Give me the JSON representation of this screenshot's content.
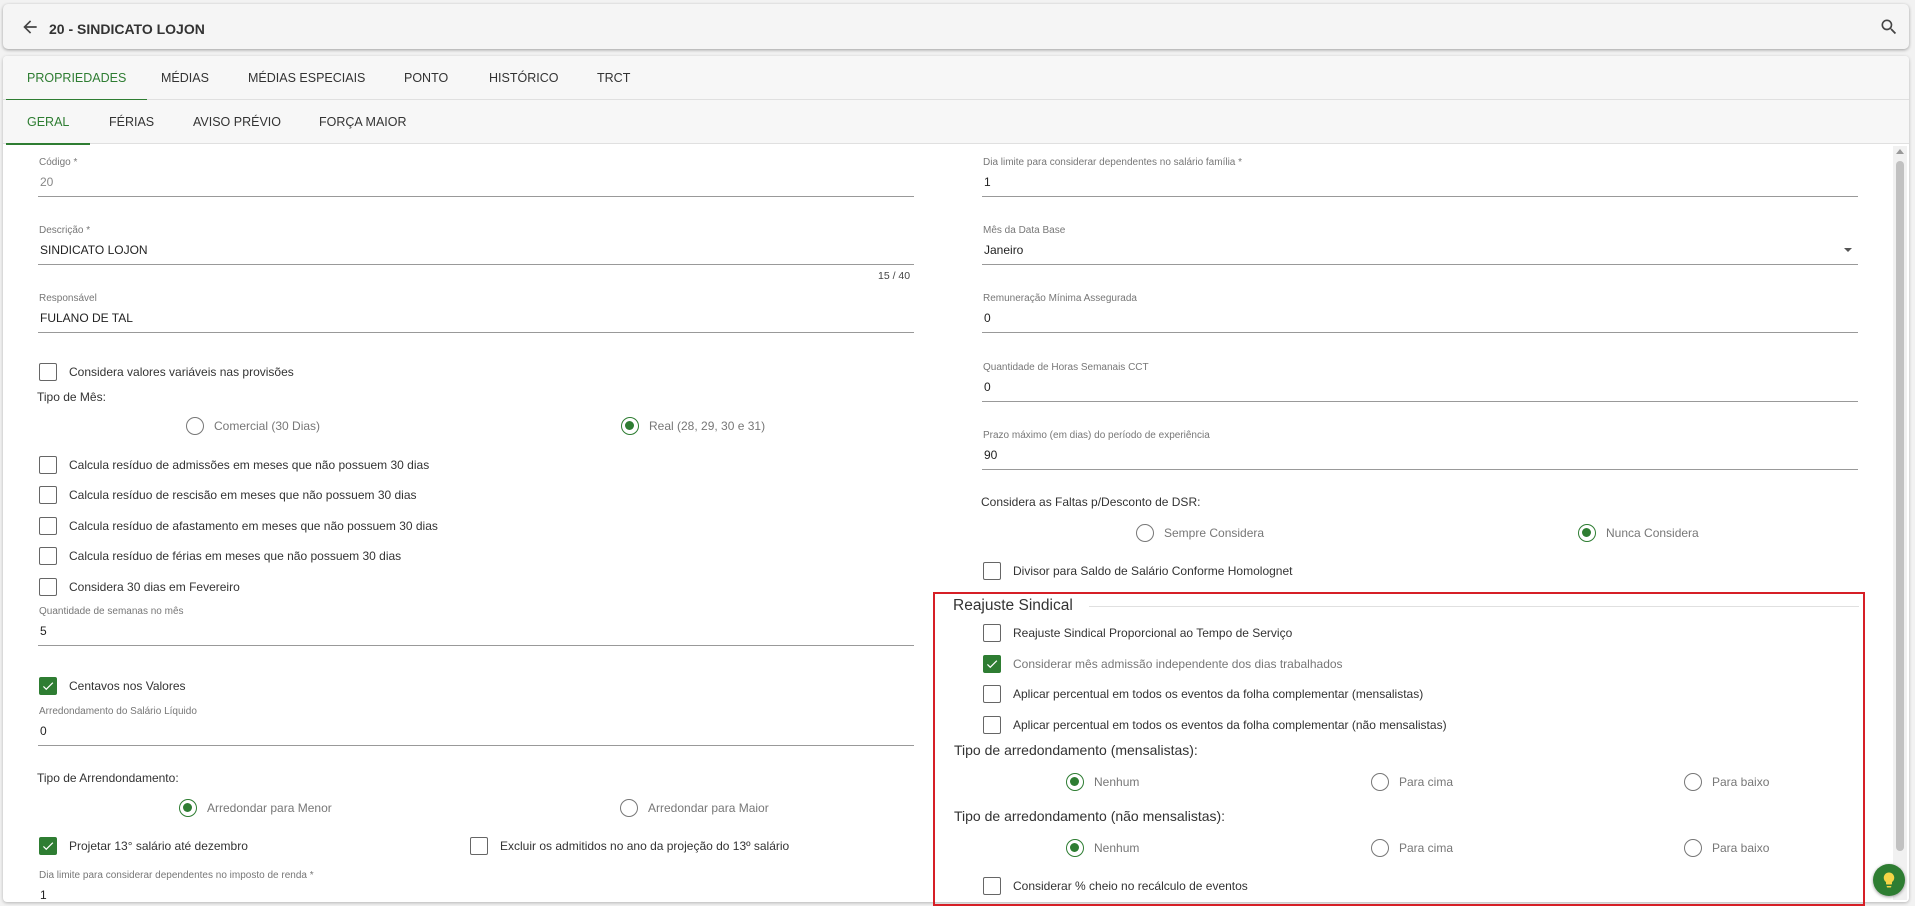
{
  "header": {
    "title": "20 - SINDICATO LOJON"
  },
  "tabs_main": [
    "PROPRIEDADES",
    "MÉDIAS",
    "MÉDIAS ESPECIAIS",
    "PONTO",
    "HISTÓRICO",
    "TRCT"
  ],
  "tabs_sub": [
    "GERAL",
    "FÉRIAS",
    "AVISO PRÉVIO",
    "FORÇA MAIOR"
  ],
  "left": {
    "codigo": {
      "label": "Código *",
      "value": "20"
    },
    "descricao": {
      "label": "Descrição *",
      "value": "SINDICATO LOJON",
      "counter": "15 / 40"
    },
    "responsavel": {
      "label": "Responsável",
      "value": "FULANO DE TAL"
    },
    "cb_variaveis": {
      "label": "Considera valores variáveis nas provisões",
      "checked": false
    },
    "tipo_mes": {
      "label": "Tipo de Mês:",
      "options": [
        "Comercial (30 Dias)",
        "Real (28, 29, 30 e 31)"
      ],
      "selected": "Real (28, 29, 30 e 31)"
    },
    "cb_admissoes": {
      "label": "Calcula resíduo de admissões em meses que não possuem 30 dias",
      "checked": false
    },
    "cb_rescisao": {
      "label": "Calcula resíduo de rescisão em meses que não possuem 30 dias",
      "checked": false
    },
    "cb_afastamento": {
      "label": "Calcula resíduo de afastamento em meses que não possuem 30 dias",
      "checked": false
    },
    "cb_ferias": {
      "label": "Calcula resíduo de férias em meses que não possuem 30 dias",
      "checked": false
    },
    "cb_fevereiro": {
      "label": "Considera 30 dias em Fevereiro",
      "checked": false
    },
    "semanas": {
      "label": "Quantidade de semanas no mês",
      "value": "5"
    },
    "cb_centavos": {
      "label": "Centavos nos Valores",
      "checked": true
    },
    "arredondamento_liquido": {
      "label": "Arredondamento do Salário Líquido",
      "value": "0"
    },
    "tipo_arredondamento": {
      "label": "Tipo de Arrendondamento:",
      "options": [
        "Arredondar para Menor",
        "Arredondar para Maior"
      ],
      "selected": "Arredondar para Menor"
    },
    "cb_projetar": {
      "label": "Projetar 13° salário até dezembro",
      "checked": true
    },
    "cb_excluir": {
      "label": "Excluir os admitidos no ano da projeção do 13º salário",
      "checked": false
    },
    "dia_limite_ir": {
      "label": "Dia limite para considerar dependentes no imposto de renda *",
      "value": "1"
    }
  },
  "right": {
    "dia_limite_sf": {
      "label": "Dia limite para considerar dependentes no salário família *",
      "value": "1"
    },
    "mes_data_base": {
      "label": "Mês da Data Base",
      "value": "Janeiro"
    },
    "remuneracao": {
      "label": "Remuneração Mínima Assegurada",
      "value": "0"
    },
    "horas_semanais": {
      "label": "Quantidade de Horas Semanais CCT",
      "value": "0"
    },
    "prazo_experiencia": {
      "label": "Prazo máximo (em dias) do período de experiência",
      "value": "90"
    },
    "faltas_dsr": {
      "label": "Considera as Faltas p/Desconto de DSR:",
      "options": [
        "Sempre Considera",
        "Nunca Considera"
      ],
      "selected": "Nunca Considera"
    },
    "cb_divisor": {
      "label": "Divisor para Saldo de Salário Conforme Homolognet",
      "checked": false
    }
  },
  "reajuste": {
    "legend": "Reajuste Sindical",
    "cb_proporcional": {
      "label": "Reajuste Sindical Proporcional ao Tempo de Serviço",
      "checked": false
    },
    "cb_mes_admissao": {
      "label": "Considerar mês admissão independente dos dias trabalhados",
      "checked": true
    },
    "cb_mensalistas": {
      "label": "Aplicar percentual em todos os eventos da folha complementar (mensalistas)",
      "checked": false
    },
    "cb_nao_mensalistas": {
      "label": "Aplicar percentual em todos os eventos da folha complementar (não mensalistas)",
      "checked": false
    },
    "tipo_mensalistas": {
      "label": "Tipo de arredondamento (mensalistas):",
      "options": [
        "Nenhum",
        "Para cima",
        "Para baixo"
      ],
      "selected": "Nenhum"
    },
    "tipo_nao_mensalistas": {
      "label": "Tipo de arredondamento (não mensalistas):",
      "options": [
        "Nenhum",
        "Para cima",
        "Para baixo"
      ],
      "selected": "Nenhum"
    },
    "cb_cheio": {
      "label": "Considerar % cheio no recálculo de eventos",
      "checked": false
    }
  },
  "icons": {
    "back": "arrow-left-icon",
    "search": "search-icon",
    "checkmark": "checkmark-icon",
    "dropdown": "chevron-down-icon",
    "help": "lightbulb-icon"
  },
  "colors": {
    "accent": "#2e7d32",
    "highlight_border": "#d61f26"
  }
}
